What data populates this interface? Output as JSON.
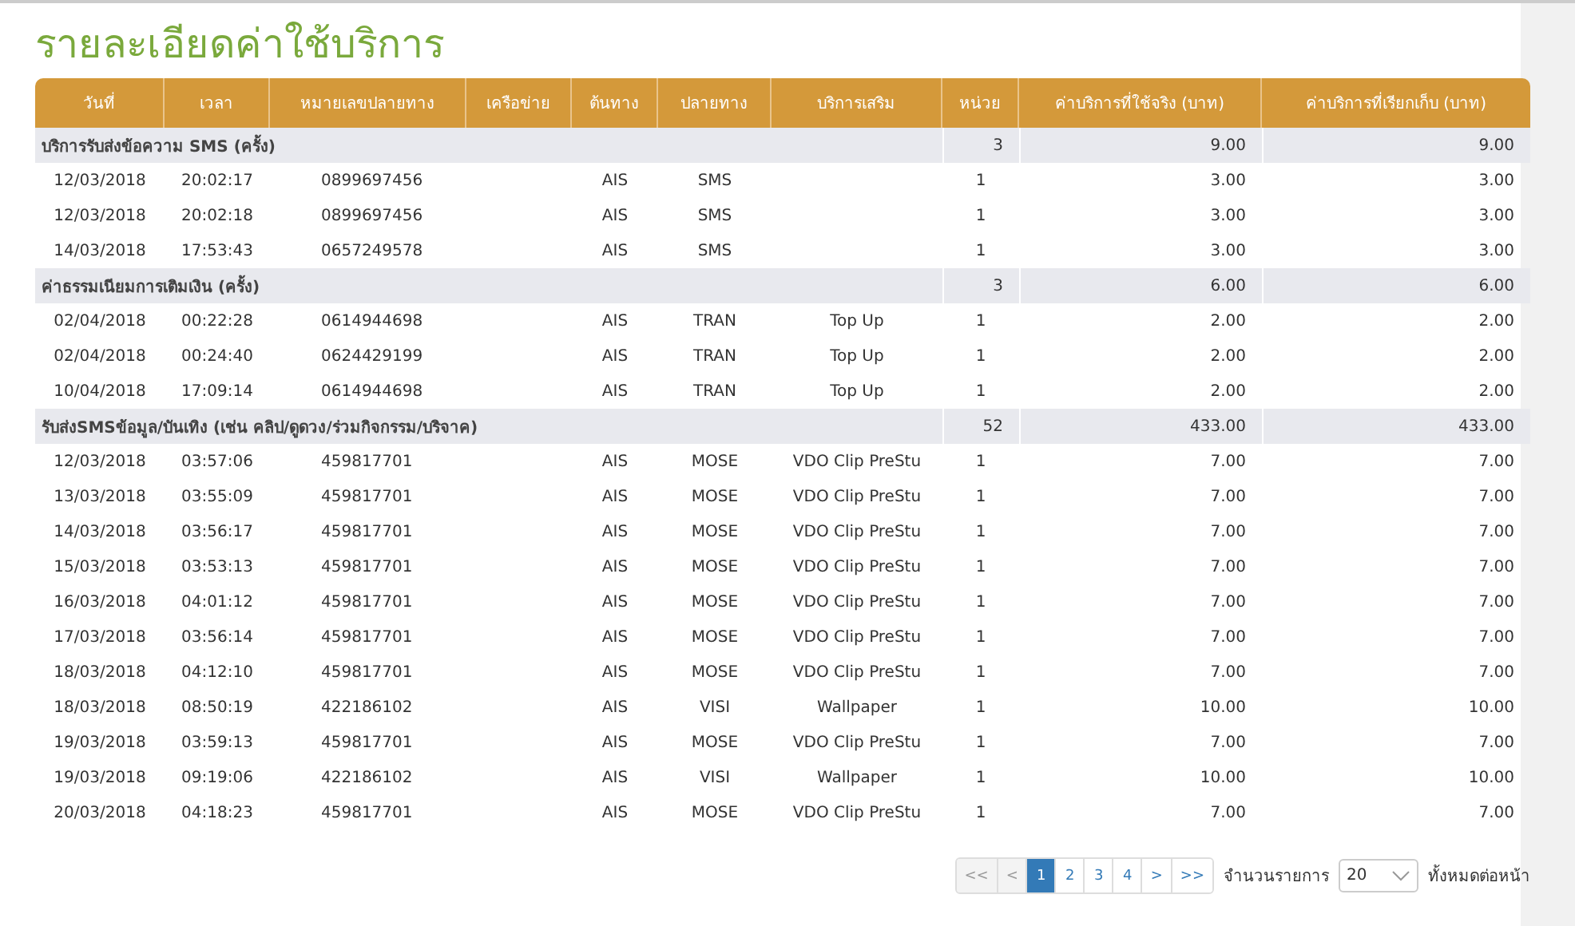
{
  "title": "รายละเอียดค่าใช้บริการ",
  "table": {
    "columns": [
      "วันที่",
      "เวลา",
      "หมายเลขปลายทาง",
      "เครือข่าย",
      "ต้นทาง",
      "ปลายทาง",
      "บริการเสริม",
      "หน่วย",
      "ค่าบริการที่ใช้จริง (บาท)",
      "ค่าบริการที่เรียกเก็บ (บาท)"
    ],
    "groups": [
      {
        "name": "บริการรับส่งข้อความ SMS (ครั้ง)",
        "units": "3",
        "actual": "9.00",
        "billed": "9.00",
        "rows": [
          [
            "12/03/2018",
            "20:02:17",
            "0899697456",
            "",
            "AIS",
            "SMS",
            "",
            "1",
            "3.00",
            "3.00"
          ],
          [
            "12/03/2018",
            "20:02:18",
            "0899697456",
            "",
            "AIS",
            "SMS",
            "",
            "1",
            "3.00",
            "3.00"
          ],
          [
            "14/03/2018",
            "17:53:43",
            "0657249578",
            "",
            "AIS",
            "SMS",
            "",
            "1",
            "3.00",
            "3.00"
          ]
        ]
      },
      {
        "name": "ค่าธรรมเนียมการเติมเงิน (ครั้ง)",
        "units": "3",
        "actual": "6.00",
        "billed": "6.00",
        "rows": [
          [
            "02/04/2018",
            "00:22:28",
            "0614944698",
            "",
            "AIS",
            "TRAN",
            "Top Up",
            "1",
            "2.00",
            "2.00"
          ],
          [
            "02/04/2018",
            "00:24:40",
            "0624429199",
            "",
            "AIS",
            "TRAN",
            "Top Up",
            "1",
            "2.00",
            "2.00"
          ],
          [
            "10/04/2018",
            "17:09:14",
            "0614944698",
            "",
            "AIS",
            "TRAN",
            "Top Up",
            "1",
            "2.00",
            "2.00"
          ]
        ]
      },
      {
        "name": "รับส่งSMSข้อมูล/บันเทิง (เช่น คลิป/ดูดวง/ร่วมกิจกรรม/บริจาค)",
        "units": "52",
        "actual": "433.00",
        "billed": "433.00",
        "rows": [
          [
            "12/03/2018",
            "03:57:06",
            "459817701",
            "",
            "AIS",
            "MOSE",
            "VDO Clip PreStu",
            "1",
            "7.00",
            "7.00"
          ],
          [
            "13/03/2018",
            "03:55:09",
            "459817701",
            "",
            "AIS",
            "MOSE",
            "VDO Clip PreStu",
            "1",
            "7.00",
            "7.00"
          ],
          [
            "14/03/2018",
            "03:56:17",
            "459817701",
            "",
            "AIS",
            "MOSE",
            "VDO Clip PreStu",
            "1",
            "7.00",
            "7.00"
          ],
          [
            "15/03/2018",
            "03:53:13",
            "459817701",
            "",
            "AIS",
            "MOSE",
            "VDO Clip PreStu",
            "1",
            "7.00",
            "7.00"
          ],
          [
            "16/03/2018",
            "04:01:12",
            "459817701",
            "",
            "AIS",
            "MOSE",
            "VDO Clip PreStu",
            "1",
            "7.00",
            "7.00"
          ],
          [
            "17/03/2018",
            "03:56:14",
            "459817701",
            "",
            "AIS",
            "MOSE",
            "VDO Clip PreStu",
            "1",
            "7.00",
            "7.00"
          ],
          [
            "18/03/2018",
            "04:12:10",
            "459817701",
            "",
            "AIS",
            "MOSE",
            "VDO Clip PreStu",
            "1",
            "7.00",
            "7.00"
          ],
          [
            "18/03/2018",
            "08:50:19",
            "422186102",
            "",
            "AIS",
            "VISI",
            "Wallpaper",
            "1",
            "10.00",
            "10.00"
          ],
          [
            "19/03/2018",
            "03:59:13",
            "459817701",
            "",
            "AIS",
            "MOSE",
            "VDO Clip PreStu",
            "1",
            "7.00",
            "7.00"
          ],
          [
            "19/03/2018",
            "09:19:06",
            "422186102",
            "",
            "AIS",
            "VISI",
            "Wallpaper",
            "1",
            "10.00",
            "10.00"
          ],
          [
            "20/03/2018",
            "04:18:23",
            "459817701",
            "",
            "AIS",
            "MOSE",
            "VDO Clip PreStu",
            "1",
            "7.00",
            "7.00"
          ]
        ]
      }
    ]
  },
  "pagination": {
    "buttons": [
      {
        "label": "<<",
        "disabled": true,
        "selected": false
      },
      {
        "label": "<",
        "disabled": true,
        "selected": false
      },
      {
        "label": "1",
        "disabled": false,
        "selected": true
      },
      {
        "label": "2",
        "disabled": false,
        "selected": false
      },
      {
        "label": "3",
        "disabled": false,
        "selected": false
      },
      {
        "label": "4",
        "disabled": false,
        "selected": false
      },
      {
        "label": ">",
        "disabled": false,
        "selected": false
      },
      {
        "label": ">>",
        "disabled": false,
        "selected": false
      }
    ],
    "per_page_label": "จำนวนรายการ",
    "per_page": "20",
    "suffix": "ทั้งหมดต่อหน้า"
  }
}
